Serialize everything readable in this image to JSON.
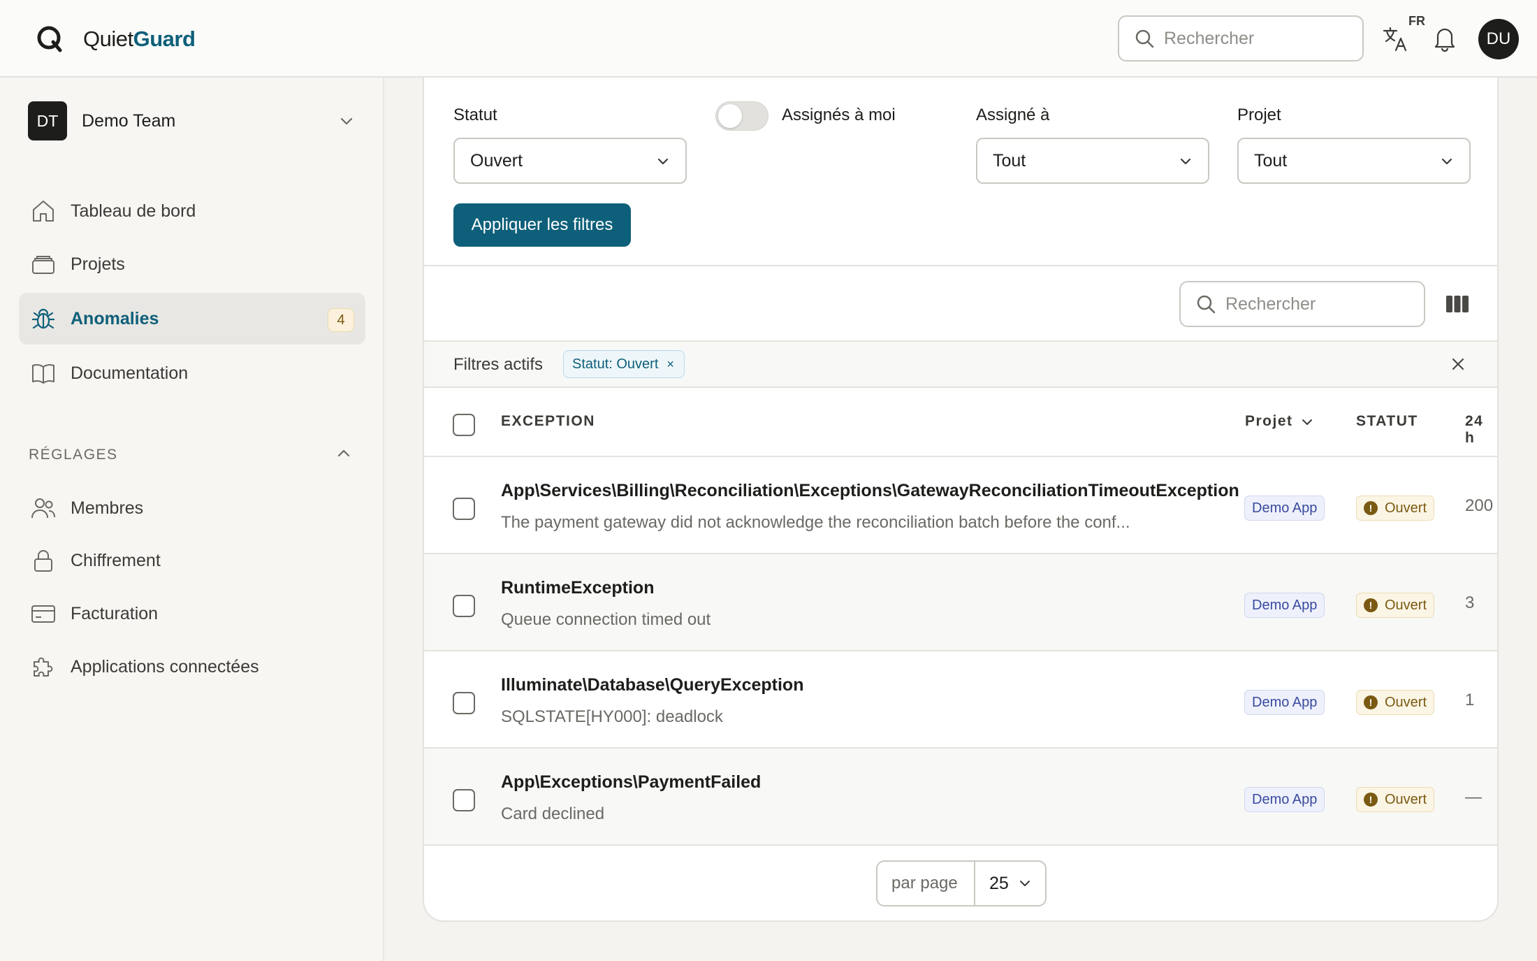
{
  "app": {
    "brand_part1": "Quiet",
    "brand_part2": "Guard",
    "search_placeholder": "Rechercher",
    "language": "FR",
    "user_initials": "DU",
    "accent_color": "#0e5f7a"
  },
  "sidebar": {
    "team_initials": "DT",
    "team_name": "Demo Team",
    "items": [
      {
        "label": "Tableau de bord",
        "icon": "home-icon"
      },
      {
        "label": "Projets",
        "icon": "folder-stack-icon"
      },
      {
        "label": "Anomalies",
        "icon": "bug-icon",
        "badge": "4",
        "active": true
      },
      {
        "label": "Documentation",
        "icon": "book-icon"
      }
    ],
    "settings_title": "RÉGLAGES",
    "settings_items": [
      {
        "label": "Membres",
        "icon": "users-icon"
      },
      {
        "label": "Chiffrement",
        "icon": "lock-icon"
      },
      {
        "label": "Facturation",
        "icon": "credit-card-icon"
      },
      {
        "label": "Applications connectées",
        "icon": "puzzle-icon"
      }
    ]
  },
  "filters": {
    "status_label": "Statut",
    "status_value": "Ouvert",
    "assigned_to_me_label": "Assignés à moi",
    "assigned_to_label": "Assigné à",
    "assigned_to_value": "Tout",
    "project_label": "Projet",
    "project_value": "Tout",
    "apply_label": "Appliquer les filtres",
    "table_search_placeholder": "Rechercher",
    "active_filters_label": "Filtres actifs",
    "active_chip": "Statut: Ouvert",
    "chip_remove": "×"
  },
  "table": {
    "headers": {
      "exception": "EXCEPTION",
      "project": "Projet",
      "status": "STATUT",
      "last24": "24 h"
    },
    "rows": [
      {
        "title": "App\\Services\\Billing\\Reconciliation\\Exceptions\\GatewayReconciliationTimeoutException",
        "message": "The payment gateway did not acknowledge the reconciliation batch before the conf...",
        "project": "Demo App",
        "status": "Ouvert",
        "count": "200"
      },
      {
        "title": "RuntimeException",
        "message": "Queue connection timed out",
        "project": "Demo App",
        "status": "Ouvert",
        "count": "3"
      },
      {
        "title": "Illuminate\\Database\\QueryException",
        "message": "SQLSTATE[HY000]: deadlock",
        "project": "Demo App",
        "status": "Ouvert",
        "count": "1"
      },
      {
        "title": "App\\Exceptions\\PaymentFailed",
        "message": "Card declined",
        "project": "Demo App",
        "status": "Ouvert",
        "count": "—"
      }
    ]
  },
  "pagination": {
    "per_page_label": "par page",
    "per_page_value": "25"
  }
}
